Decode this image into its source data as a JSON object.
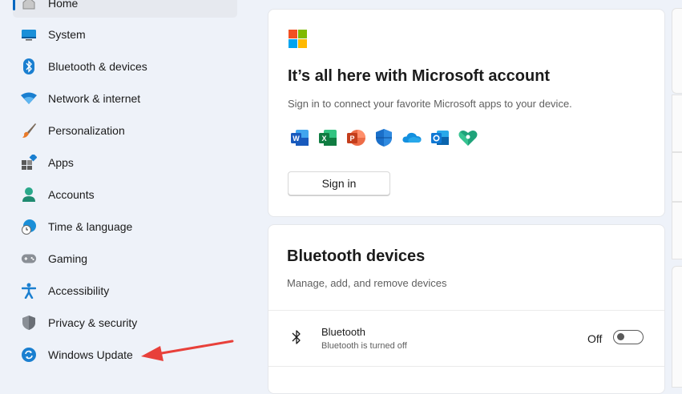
{
  "sidebar": {
    "items": [
      {
        "label": "Home",
        "icon": "home-icon"
      },
      {
        "label": "System",
        "icon": "system-icon"
      },
      {
        "label": "Bluetooth & devices",
        "icon": "bluetooth-icon"
      },
      {
        "label": "Network & internet",
        "icon": "wifi-icon"
      },
      {
        "label": "Personalization",
        "icon": "brush-icon"
      },
      {
        "label": "Apps",
        "icon": "apps-icon"
      },
      {
        "label": "Accounts",
        "icon": "person-icon"
      },
      {
        "label": "Time & language",
        "icon": "globe-clock-icon"
      },
      {
        "label": "Gaming",
        "icon": "gamepad-icon"
      },
      {
        "label": "Accessibility",
        "icon": "accessibility-icon"
      },
      {
        "label": "Privacy & security",
        "icon": "shield-icon"
      },
      {
        "label": "Windows Update",
        "icon": "update-icon"
      }
    ]
  },
  "account_card": {
    "title": "It’s all here with Microsoft account",
    "subtitle": "Sign in to connect your favorite Microsoft apps to your device.",
    "apps": [
      "word-icon",
      "excel-icon",
      "powerpoint-icon",
      "defender-icon",
      "onedrive-icon",
      "outlook-icon",
      "family-safety-icon"
    ],
    "sign_in_label": "Sign in"
  },
  "bluetooth_card": {
    "title": "Bluetooth devices",
    "subtitle": "Manage, add, and remove devices",
    "row": {
      "title": "Bluetooth",
      "subtitle": "Bluetooth is turned off",
      "toggle_label": "Off",
      "toggle_on": false
    }
  },
  "colors": {
    "accent": "#0067c0",
    "annotation_arrow": "#e8403a"
  }
}
